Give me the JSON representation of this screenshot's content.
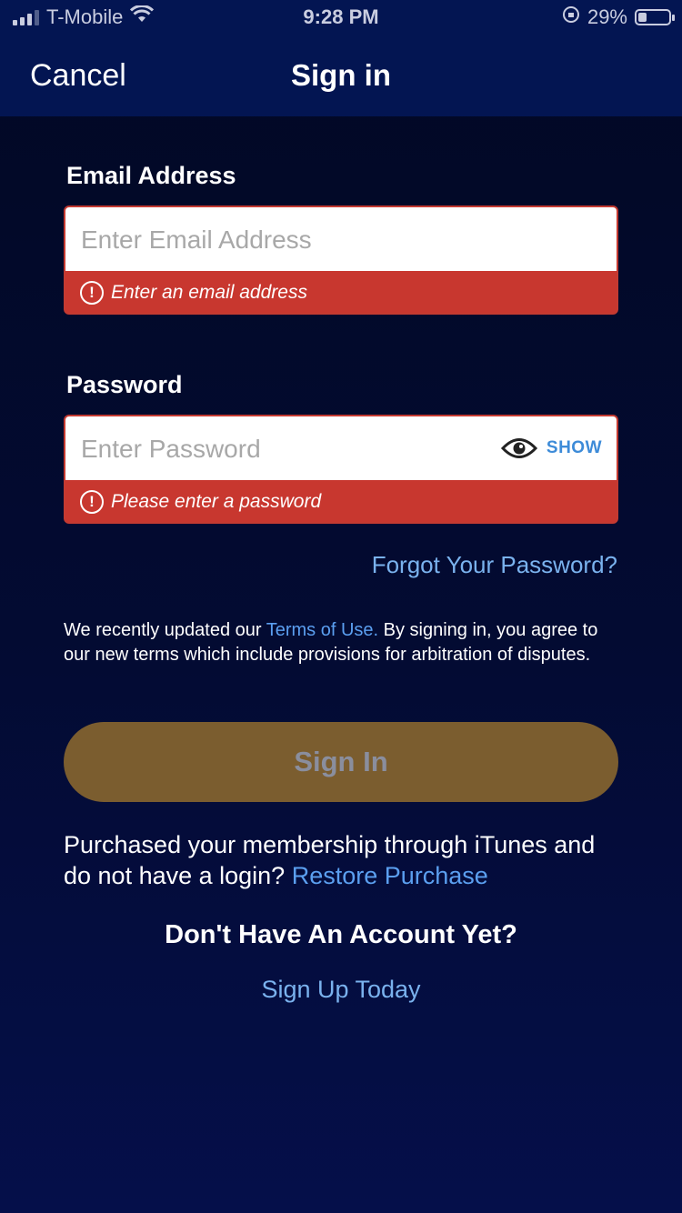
{
  "status_bar": {
    "carrier": "T-Mobile",
    "time": "9:28 PM",
    "battery_percent": "29%",
    "battery_level": 0.29
  },
  "header": {
    "cancel_label": "Cancel",
    "title": "Sign in"
  },
  "email": {
    "label": "Email Address",
    "placeholder": "Enter Email Address",
    "value": "",
    "error": "Enter an email address"
  },
  "password": {
    "label": "Password",
    "placeholder": "Enter Password",
    "value": "",
    "show_label": "SHOW",
    "error": "Please enter a password"
  },
  "forgot_password": "Forgot Your Password?",
  "terms": {
    "prefix": "We recently updated our ",
    "link": "Terms of Use.",
    "suffix": " By signing in, you agree to our new terms which include provisions for arbitration of disputes."
  },
  "sign_in_button": "Sign In",
  "itunes": {
    "text": "Purchased your membership through iTunes and do not have a login? ",
    "link": "Restore Purchase"
  },
  "no_account": "Don't Have An Account Yet?",
  "sign_up": "Sign Up Today",
  "colors": {
    "header_bg": "#031552",
    "error_red": "#c8372f",
    "link_blue": "#5b9ff0",
    "button_gold": "#7b5d2f"
  },
  "icons": [
    "signal-icon",
    "wifi-icon",
    "orientation-lock-icon",
    "battery-icon",
    "alert-icon",
    "eye-icon"
  ]
}
